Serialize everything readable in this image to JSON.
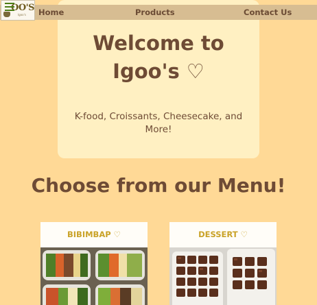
{
  "nav": {
    "logo": {
      "text": "OO'S",
      "subtext": "Igoo's",
      "alt": "Igoo's logo"
    },
    "links": [
      "Home",
      "Products",
      "Contact Us"
    ]
  },
  "hero": {
    "title_line1": "Welcome to",
    "title_line2": "Igoo's ♡",
    "subtitle": "K-food, Croissants, Cheesecake, and More!"
  },
  "menu": {
    "heading": "Choose from our Menu!",
    "cards": [
      {
        "title": "BIBIMBAP ♡",
        "image": "bibimbap-photo"
      },
      {
        "title": "DESSERT ♡",
        "image": "dessert-brownies-photo"
      }
    ]
  },
  "colors": {
    "page_bg": "#ffd996",
    "nav_bg": "#d7bd92",
    "hero_bg": "#fff0c2",
    "text_brown": "#6e4b35",
    "card_title_gold": "#c9a227"
  }
}
